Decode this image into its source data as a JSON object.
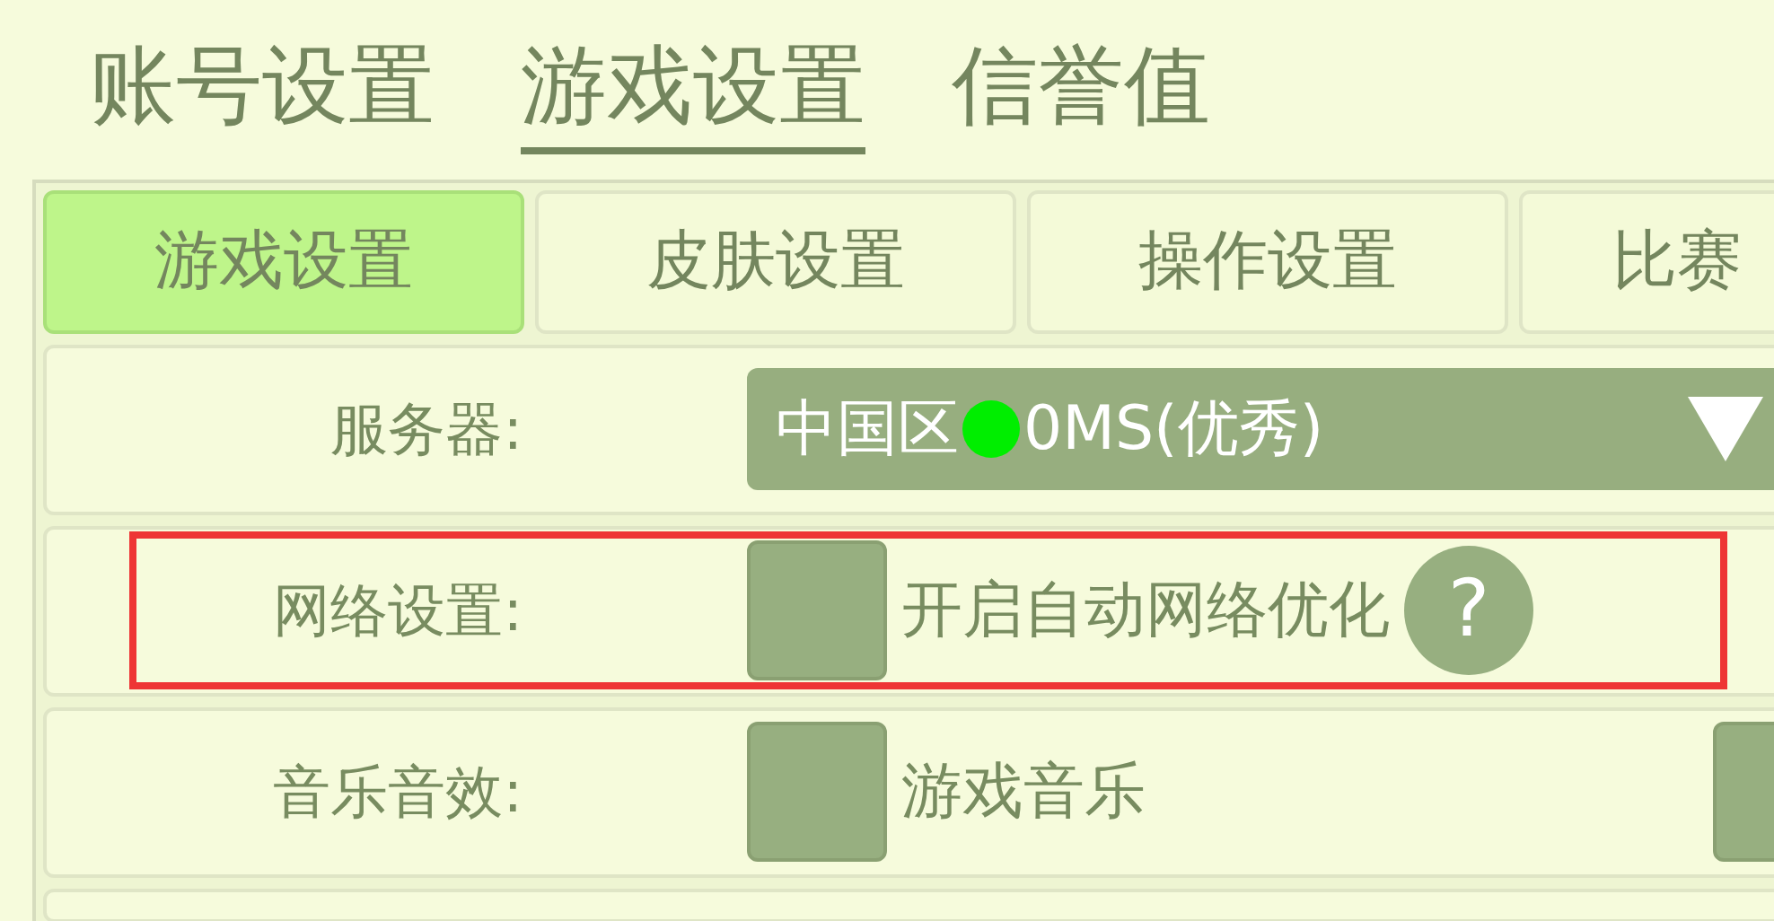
{
  "top_tabs": [
    {
      "label": "账号设置",
      "selected": false
    },
    {
      "label": "游戏设置",
      "selected": true
    },
    {
      "label": "信誉值",
      "selected": false
    }
  ],
  "sub_tabs": [
    {
      "label": "游戏设置",
      "selected": true
    },
    {
      "label": "皮肤设置",
      "selected": false
    },
    {
      "label": "操作设置",
      "selected": false
    },
    {
      "label": "比赛",
      "selected": false
    }
  ],
  "rows": [
    {
      "kind": "dropdown",
      "label": "服务器:",
      "region": "中国区",
      "color": "#00ee00",
      "latency": "0MS(优秀)",
      "highlighted": false
    },
    {
      "kind": "checkboxes",
      "label": "网络设置:",
      "highlighted": true,
      "help": "?",
      "options": [
        {
          "label": "开启自动网络优化",
          "checked": false
        }
      ]
    },
    {
      "kind": "checkboxes",
      "label": "音乐音效:",
      "highlighted": false,
      "options": [
        {
          "label": "游戏音乐",
          "checked": false
        },
        {
          "checked": false
        }
      ]
    }
  ]
}
